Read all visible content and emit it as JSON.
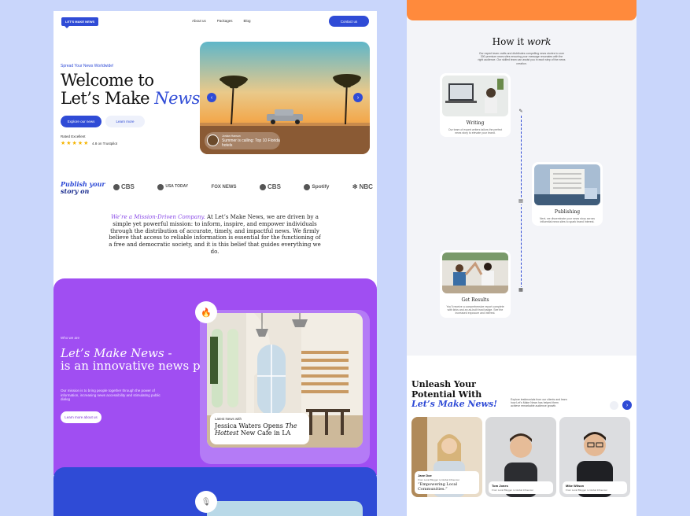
{
  "left": {
    "logo": "LET'S MAKE NEWS",
    "nav": [
      "About us",
      "Packages",
      "Blog"
    ],
    "contact": "Contact us",
    "hero": {
      "tag": "Spread Your News Worldwide!",
      "title_line1": "Welcome to",
      "title_line2": "Let’s Make ",
      "title_accent": "News!",
      "explore": "Explore our news",
      "learn": "Learn more",
      "rated": "Rated Excellent",
      "stars": "★★★★★",
      "trust": "4.8 on Trustpilot",
      "caption_small": "Jordan Hanson",
      "caption_big": "Summer is calling: Top 10 Florida hotels"
    },
    "publish": {
      "line1": "Publish your",
      "line2": "story on"
    },
    "brands": [
      "CBS",
      "USA TODAY",
      "FOX NEWS",
      "CBS",
      "Spotify",
      "NBC"
    ],
    "mission": {
      "accent": "We’re a Mission-Driven Company.",
      "text": " At Let’s Make News, we are driven by a simple yet powerful mission: to inform, inspire, and empower individuals through the distribution of accurate, timely, and impactful news. We firmly believe that access to reliable information is essential for the functioning of a free and democratic society, and it is this belief that guides everything we do."
    },
    "about": {
      "who": "Who we are",
      "title_italic": "Let’s Make News -",
      "title_rest": "is an innovative news platform",
      "desc": "Our mission is to bring people together through the power of information, increasing news accessibility and stimulating public dialog",
      "learn": "Learn more about us",
      "card_label": "Latest News with",
      "card_title_a": "Jessica Waters Opens ",
      "card_title_em": "The Hottest",
      "card_title_b": " New Cafe in LA"
    }
  },
  "right": {
    "how_a": "How it ",
    "how_em": "work",
    "how_desc": "Our expert team crafts and distributes compelling news stories to over 300 premium news sites ensuring your message resonates with the right audience. Our skilled team can assist you in each step of the news creation.",
    "steps": [
      {
        "title": "Writing",
        "desc": "Our team of expert writers tailors the perfect news story to elevate your brand."
      },
      {
        "title": "Publishing",
        "desc": "Next, we disseminate your news story across influential news sites to spark brand interest."
      },
      {
        "title": "Get Results",
        "desc": "You'll receive a comprehensive report complete with links and an as-built trust badge. See the increased exposure and interest."
      }
    ],
    "unleash": {
      "l1": "Unleash Your",
      "l2": "Potential With",
      "l3": "Let’s Make News!",
      "desc": "Explore testimonials from our clients and learn how Let’s Make News has helped them achieve remarkable audience growth."
    },
    "testimonials": [
      {
        "name": "Jane Doe",
        "role": "From Local Blogger to Global Influencer",
        "quote": "“Empowering Local Communities.”"
      },
      {
        "name": "Tom Jones",
        "role": "From Local Blogger to Global Influencer",
        "quote": ""
      },
      {
        "name": "Mike Wilson",
        "role": "From Local Blogger to Global Influencer",
        "quote": ""
      }
    ]
  },
  "colors": {
    "brand_blue": "#2f4bd6",
    "purple": "#a04ef2",
    "orange": "#ff8a3c",
    "background": "#c9d6fb"
  }
}
